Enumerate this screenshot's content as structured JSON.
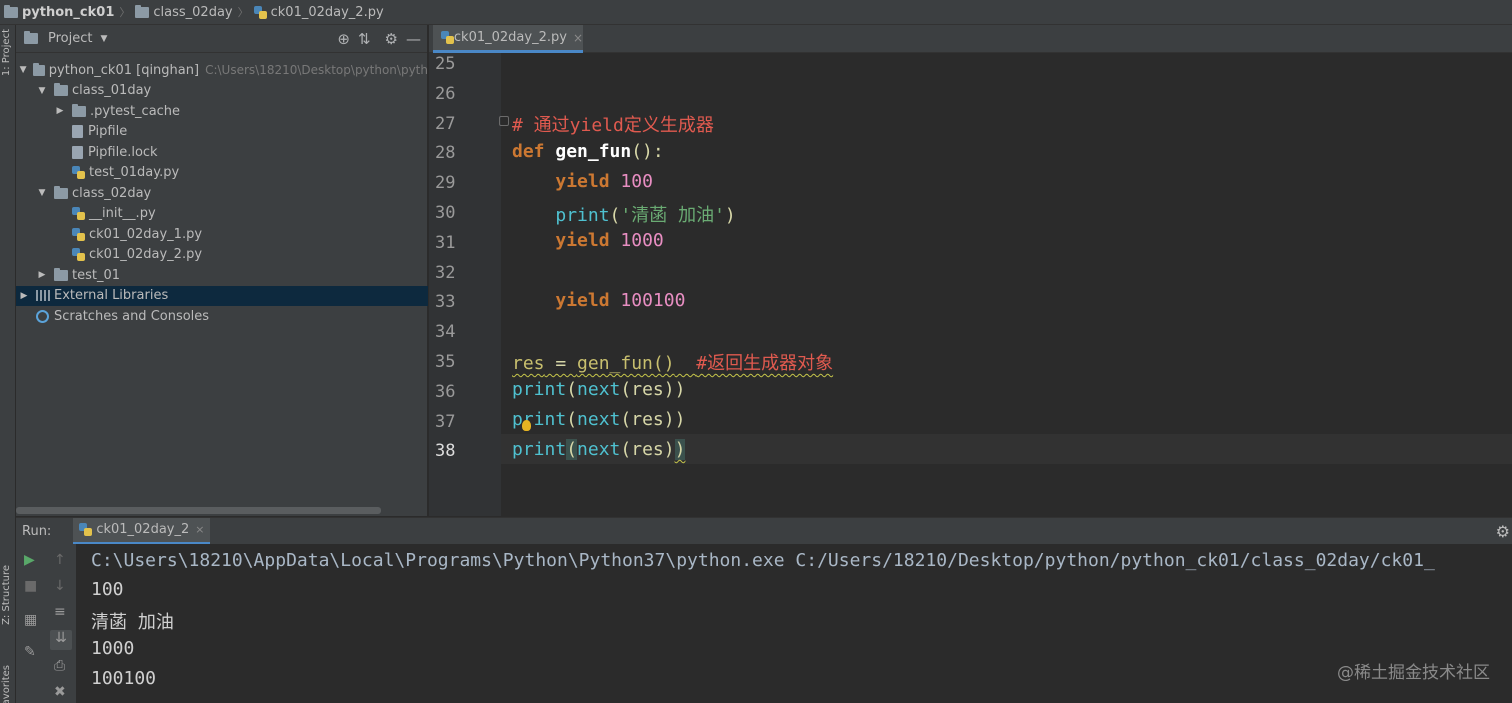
{
  "navbar": {
    "project": "python_ck01",
    "folder": "class_02day",
    "file": "ck01_02day_2.py"
  },
  "left_strip": {
    "project_label": "1: Project",
    "structure_label": "Z: Structure",
    "favorites_label": "avorites"
  },
  "project_panel": {
    "title": "Project",
    "tree": [
      {
        "label": "python_ck01 [qinghan]",
        "path": "C:\\Users\\18210\\Desktop\\python\\pyth",
        "type": "folder",
        "indent": 0,
        "expanded": true
      },
      {
        "label": "class_01day",
        "type": "folder",
        "indent": 1,
        "expanded": true
      },
      {
        "label": ".pytest_cache",
        "type": "folder",
        "indent": 2,
        "expanded": false
      },
      {
        "label": "Pipfile",
        "type": "file",
        "indent": 3
      },
      {
        "label": "Pipfile.lock",
        "type": "file",
        "indent": 3
      },
      {
        "label": "test_01day.py",
        "type": "py",
        "indent": 3
      },
      {
        "label": "class_02day",
        "type": "folder",
        "indent": 1,
        "expanded": true
      },
      {
        "label": "__init__.py",
        "type": "py",
        "indent": 3
      },
      {
        "label": "ck01_02day_1.py",
        "type": "py",
        "indent": 3
      },
      {
        "label": "ck01_02day_2.py",
        "type": "py",
        "indent": 3
      },
      {
        "label": "test_01",
        "type": "folder",
        "indent": 1,
        "expanded": false
      },
      {
        "label": "External Libraries",
        "type": "lib",
        "indent": 0,
        "expanded": false,
        "selected": true
      },
      {
        "label": "Scratches and Consoles",
        "type": "scratch",
        "indent": 0
      }
    ]
  },
  "editor": {
    "tab_label": "ck01_02day_2.py",
    "tab_close": "×",
    "line_numbers": [
      "25",
      "26",
      "27",
      "28",
      "29",
      "30",
      "31",
      "32",
      "33",
      "34",
      "35",
      "36",
      "37",
      "38"
    ],
    "current_line": "38"
  },
  "code": {
    "l27_comment": "# 通过yield定义生成器",
    "l28_def": "def",
    "l28_name": "gen_fun",
    "l28_rest": "():",
    "l29_kw": "yield",
    "l29_num": "100",
    "l30_print": "print",
    "l30_open": "(",
    "l30_str": "'清菡 加油'",
    "l30_close": ")",
    "l31_kw": "yield",
    "l31_num": "1000",
    "l33_kw": "yield",
    "l33_num": "100100",
    "l35_var": "res",
    "l35_eq": " = ",
    "l35_call": "gen_fun()",
    "l35_comment": "#返回生成器对象",
    "print_kw": "print",
    "next_kw": "next",
    "print_args": "(res)",
    "open_paren": "(",
    "close_paren": ")"
  },
  "run": {
    "label": "Run:",
    "tab_label": "ck01_02day_2",
    "tab_close": "×",
    "command": "C:\\Users\\18210\\AppData\\Local\\Programs\\Python\\Python37\\python.exe C:/Users/18210/Desktop/python/python_ck01/class_02day/ck01_",
    "output": [
      "100",
      "清菡 加油",
      "1000",
      "100100"
    ]
  },
  "watermark": "@稀土掘金技术社区",
  "icons": {
    "locate": "⊕",
    "collapse": "⇅",
    "settings": "⚙",
    "hide": "—",
    "run": "▶",
    "stop": "■",
    "up": "↑",
    "down": "↓",
    "wrap": "≡",
    "pin": "📌",
    "print": "⎙",
    "trash": "🗑"
  },
  "colors": {
    "selection": "#0d293e",
    "tab_underline": "#4a88c7",
    "comment": "#e05a4f",
    "keyword": "#cc7832"
  }
}
